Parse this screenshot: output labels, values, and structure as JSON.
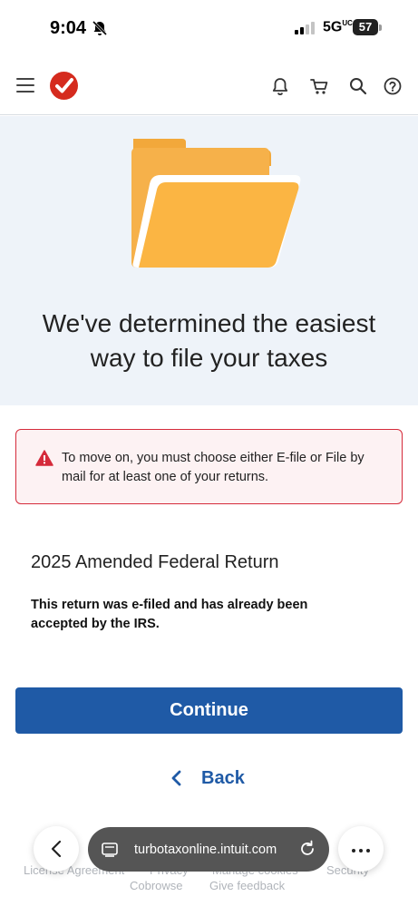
{
  "status_bar": {
    "time": "9:04",
    "network": "5G",
    "network_sup": "UC",
    "battery": "57"
  },
  "header": {
    "menu_icon": "hamburger-icon",
    "logo": "turbotax-check-logo",
    "icons": [
      "bell-icon",
      "cart-icon",
      "search-icon",
      "help-icon"
    ],
    "brand_color": "#d52b1e"
  },
  "hero": {
    "illustration": "folder-icon",
    "title": "We've determined the easiest way to file your taxes",
    "background": "#eef3f9"
  },
  "alert": {
    "icon": "warning-icon",
    "text": "To move on, you must choose either E-file or File by mail for at least one of your returns.",
    "border_color": "#d52b3b"
  },
  "return": {
    "title": "2025 Amended Federal Return",
    "description": "This return was e-filed and has already been accepted by the IRS."
  },
  "actions": {
    "continue_label": "Continue",
    "back_label": "Back",
    "accent": "#1f5aa6"
  },
  "footer": {
    "license": "License Agreement",
    "privacy": "Privacy",
    "cookies": "Manage cookies",
    "security": "Security",
    "cobrowse": "Cobrowse",
    "feedback": "Give feedback"
  },
  "browser": {
    "url": "turbotaxonline.intuit.com"
  }
}
